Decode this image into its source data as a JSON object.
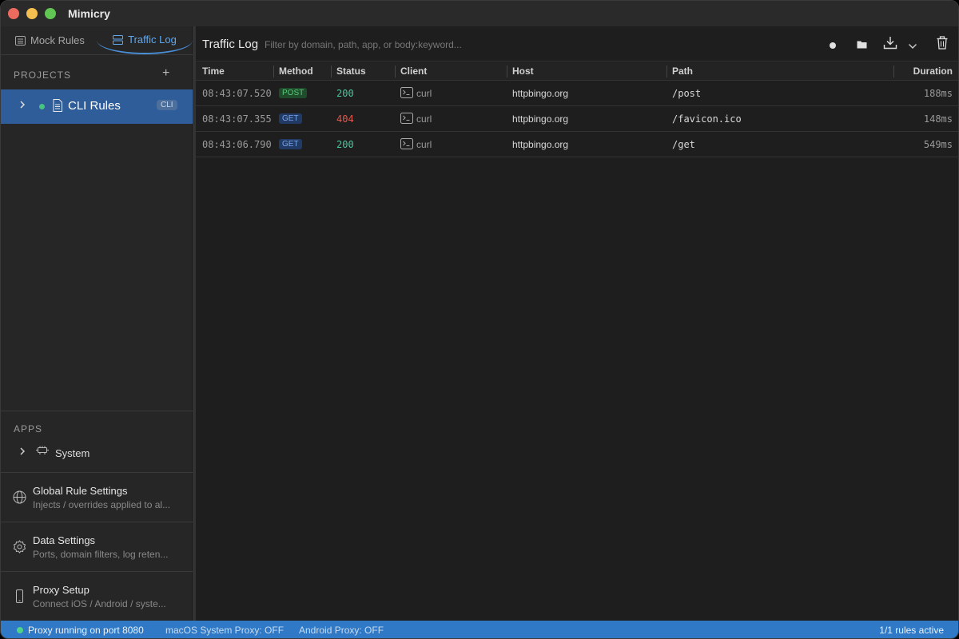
{
  "window": {
    "title": "Mimicry"
  },
  "sidebar": {
    "tabs": [
      {
        "label": "Mock Rules",
        "icon": "list-icon",
        "active": false
      },
      {
        "label": "Traffic Log",
        "icon": "server-icon",
        "active": true
      }
    ],
    "projects_header": "PROJECTS",
    "add_symbol": "+",
    "projects": [
      {
        "label": "CLI Rules",
        "badge": "CLI",
        "status": "active"
      }
    ],
    "apps_header": "APPS",
    "apps": [
      {
        "label": "System"
      }
    ],
    "settings": [
      {
        "title": "Global Rule Settings",
        "subtitle": "Injects / overrides applied to al...",
        "icon": "globe-icon"
      },
      {
        "title": "Data Settings",
        "subtitle": "Ports, domain filters, log reten...",
        "icon": "gear-icon"
      },
      {
        "title": "Proxy Setup",
        "subtitle": "Connect iOS / Android / syste...",
        "icon": "phone-icon"
      }
    ]
  },
  "main": {
    "title": "Traffic Log",
    "filter_placeholder": "Filter by domain, path, app, or body:keyword...",
    "columns": [
      "Time",
      "Method",
      "Status",
      "Client",
      "Host",
      "Path",
      "Duration"
    ],
    "rows": [
      {
        "time": "08:43:07.520",
        "method": "POST",
        "status": "200",
        "client": "curl",
        "host": "httpbingo.org",
        "path": "/post",
        "duration": "188ms"
      },
      {
        "time": "08:43:07.355",
        "method": "GET",
        "status": "404",
        "client": "curl",
        "host": "httpbingo.org",
        "path": "/favicon.ico",
        "duration": "148ms"
      },
      {
        "time": "08:43:06.790",
        "method": "GET",
        "status": "200",
        "client": "curl",
        "host": "httpbingo.org",
        "path": "/get",
        "duration": "549ms"
      }
    ]
  },
  "statusbar": {
    "proxy": "Proxy running on port 8080",
    "macos_proxy": "macOS System Proxy: OFF",
    "android_proxy": "Android Proxy: OFF",
    "rules": "1/1 rules active"
  },
  "colors": {
    "accent": "#2f79c6",
    "selection": "#2f5d9a",
    "status_ok": "#4fc49b",
    "status_error": "#e4574c"
  }
}
